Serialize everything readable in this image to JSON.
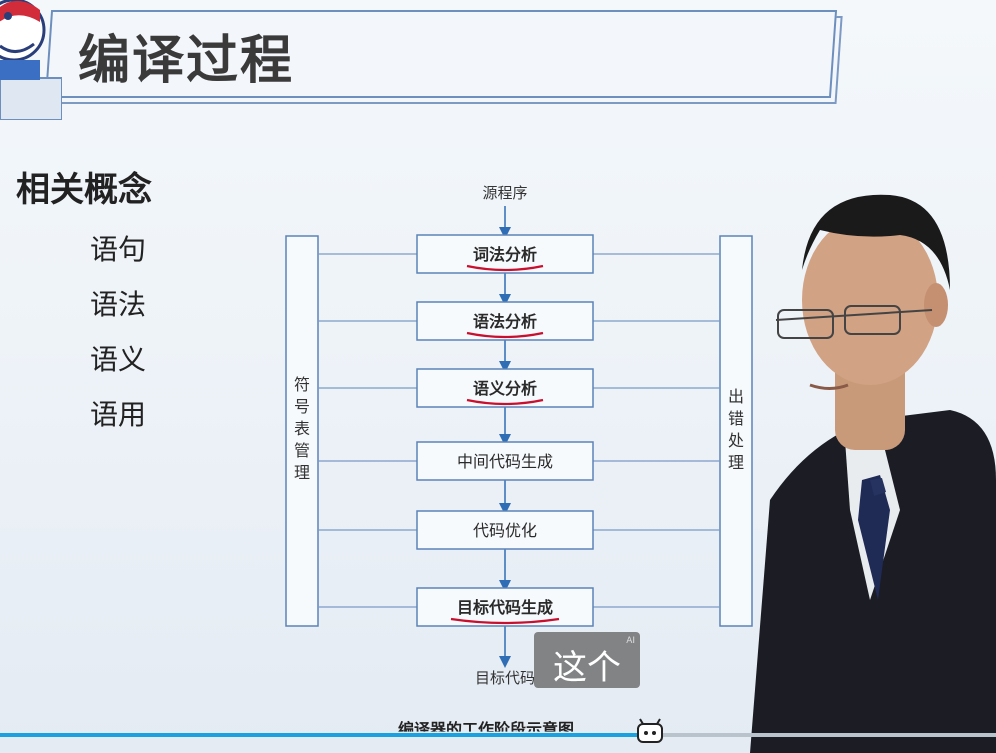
{
  "slide": {
    "title": "编译过程",
    "concepts_heading": "相关概念",
    "concepts": [
      "语句",
      "语法",
      "语义",
      "语用"
    ]
  },
  "diagram": {
    "source_label": "源程序",
    "target_label": "目标代码",
    "left_box": "符号表管理",
    "right_box": "出错处理",
    "stages": [
      "词法分析",
      "语法分析",
      "语义分析",
      "中间代码生成",
      "代码优化",
      "目标代码生成"
    ],
    "underlined_stages": [
      0,
      1,
      2,
      5
    ],
    "caption": "编译器的工作阶段示意图"
  },
  "subtitle": {
    "text": "这个",
    "badge": "AI"
  },
  "player": {
    "progress_fraction": 0.64
  },
  "colors": {
    "accent_blue": "#2f6db5",
    "underline_red": "#c8102e",
    "progress": "#1aa1e0"
  }
}
